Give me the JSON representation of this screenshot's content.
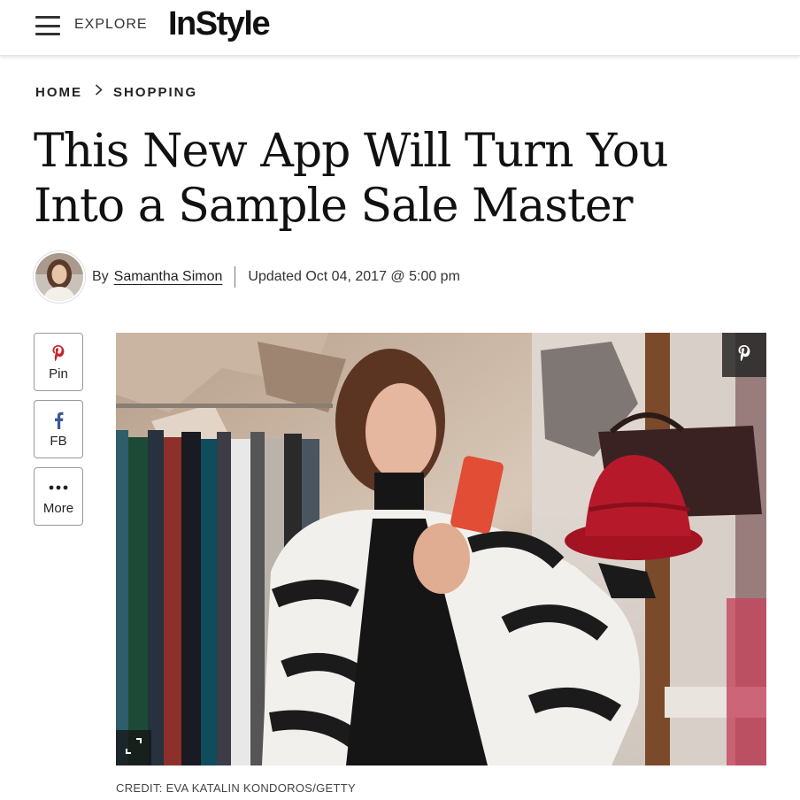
{
  "header": {
    "explore_label": "EXPLORE",
    "logo_text": "InStyle"
  },
  "breadcrumb": {
    "items": [
      "HOME",
      "SHOPPING"
    ],
    "separator": ">"
  },
  "article": {
    "title": "This New App Will Turn You Into a Sample Sale Master",
    "byline_prefix": "By",
    "author": "Samantha Simon",
    "updated": "Updated Oct 04, 2017 @ 5:00 pm"
  },
  "share": {
    "pin_label": "Pin",
    "fb_label": "FB",
    "more_label": "More"
  },
  "image": {
    "credit": "CREDIT: EVA KATALIN KONDOROS/GETTY"
  },
  "colors": {
    "pinterest": "#c8232c",
    "facebook": "#3b5998",
    "text": "#1a1a1a"
  },
  "icons": {
    "menu": "hamburger-icon",
    "pin": "pinterest-icon",
    "fb": "facebook-icon",
    "more": "ellipsis-icon",
    "expand": "expand-icon"
  }
}
